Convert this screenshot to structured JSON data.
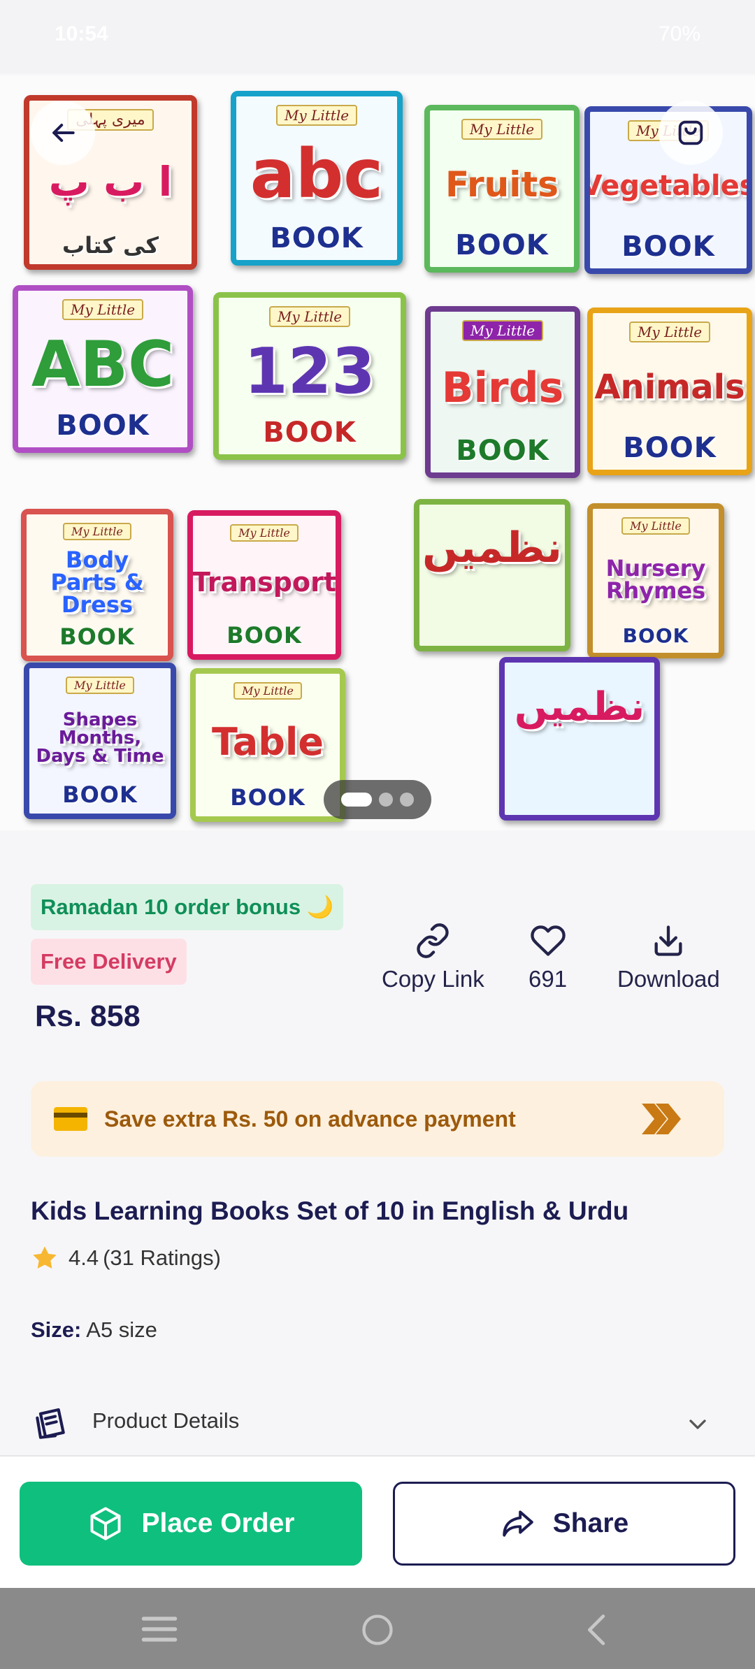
{
  "status_bar": {
    "time": "10:54",
    "battery": "70%"
  },
  "gallery": {
    "image_count": 3,
    "active_index": 0,
    "books": [
      {
        "tag": "میری پہلی",
        "big": "ا ب پ",
        "word": "کی کتاب"
      },
      {
        "tag": "My Little",
        "big": "abc",
        "word": "BOOK"
      },
      {
        "tag": "My Little",
        "big": "Fruits",
        "word": "BOOK"
      },
      {
        "tag": "My Little",
        "big": "Vegetables",
        "word": "BOOK"
      },
      {
        "tag": "My Little",
        "big": "ABC",
        "word": "BOOK"
      },
      {
        "tag": "My Little",
        "big": "123",
        "word": "BOOK"
      },
      {
        "tag": "My Little",
        "big": "Birds",
        "word": "BOOK"
      },
      {
        "tag": "My Little",
        "big": "Animals",
        "word": "BOOK"
      },
      {
        "tag": "My Little",
        "big": "Body Parts & Dress",
        "word": "BOOK"
      },
      {
        "tag": "My Little",
        "big": "Transport",
        "word": "BOOK"
      },
      {
        "tag": "",
        "big": "نظمیں",
        "word": ""
      },
      {
        "tag": "My Little",
        "big": "Nursery Rhymes",
        "word": "BOOK"
      },
      {
        "tag": "My Little",
        "big": "Shapes Months, Days & Time",
        "word": "BOOK"
      },
      {
        "tag": "My Little",
        "big": "Table",
        "word": "BOOK"
      },
      {
        "tag": "",
        "big": "نظمیں",
        "word": ""
      }
    ]
  },
  "badges": {
    "ramadan": "Ramadan 10 order bonus 🌙",
    "free_delivery": "Free Delivery"
  },
  "price": "Rs. 858",
  "actions": {
    "copy_link": "Copy Link",
    "wishlist_count": "691",
    "download": "Download"
  },
  "advance_payment": {
    "text": "Save extra Rs. 50 on advance payment"
  },
  "product": {
    "title": "Kids Learning Books Set of 10 in English & Urdu",
    "rating_value": "4.4",
    "rating_count": "(31 Ratings)",
    "size_label": "Size:",
    "size_value": "A5 size",
    "details_label": "Product Details"
  },
  "bottom": {
    "place_order": "Place Order",
    "share": "Share"
  },
  "colors": {
    "accent_green": "#0fbf7e",
    "navy": "#1c1c52",
    "promo_bg": "#fdf0de",
    "promo_text": "#9c5a0c"
  }
}
